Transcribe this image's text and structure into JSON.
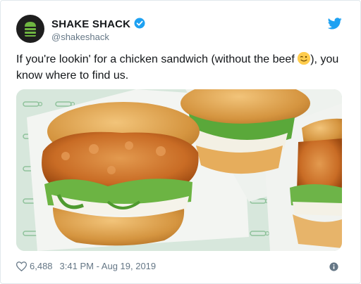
{
  "tweet": {
    "account_name": "SHAKE SHACK",
    "handle": "@shakeshack",
    "text_before_emoji": "If you're lookin' for a chicken sandwich (without the beef ",
    "text_after_emoji": "), you know where to find us.",
    "emoji": "winking-face",
    "likes": "6,488",
    "time": "3:41 PM - Aug 19, 2019"
  },
  "icons": {
    "verified": "verified-badge-icon",
    "brand": "twitter-bird-icon",
    "like": "heart-icon",
    "info": "info-icon"
  },
  "colors": {
    "twitter_blue": "#1da1f2",
    "text": "#14171a",
    "secondary": "#657786",
    "avatar_bg": "#1e1e1e",
    "logo_green": "#6fb641"
  }
}
